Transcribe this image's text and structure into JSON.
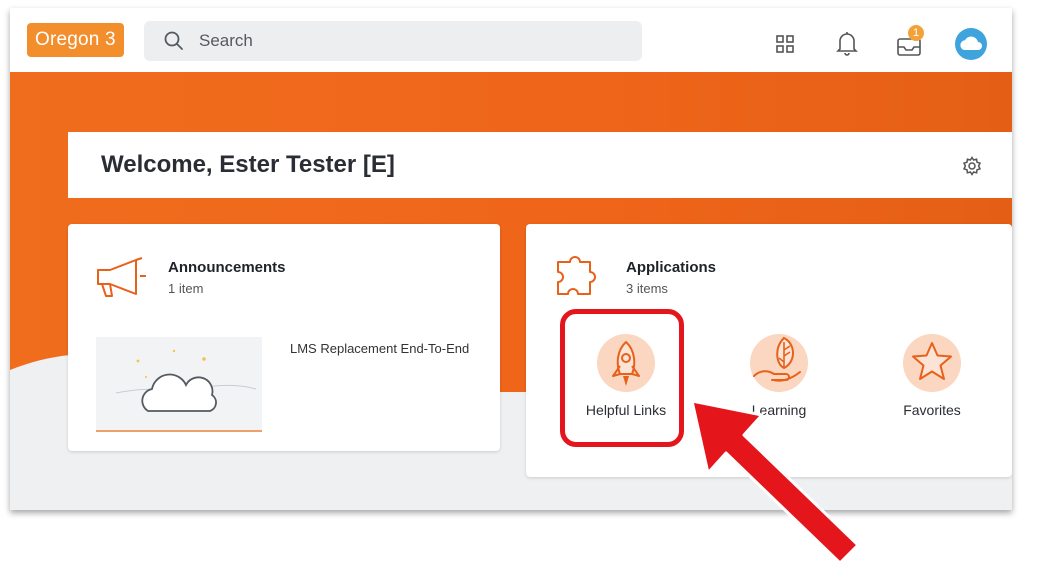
{
  "topbar": {
    "tenant_label": "Oregon 3",
    "search_label": "Search",
    "inbox_badge": "1",
    "icons": [
      "search-icon",
      "apps-grid-icon",
      "bell-icon",
      "inbox-icon",
      "cloud-avatar-icon"
    ]
  },
  "welcome": {
    "title": "Welcome, Ester Tester [E]",
    "icon": "gear-icon"
  },
  "announcements": {
    "title": "Announcements",
    "count": "1 item",
    "icon": "megaphone-icon",
    "item_title": "LMS Replacement End-To-End",
    "item_icon": "cloud-icon"
  },
  "applications": {
    "title": "Applications",
    "count": "3 items",
    "icon": "puzzle-icon",
    "apps": [
      {
        "label": "Helpful Links",
        "icon": "rocket-icon"
      },
      {
        "label": "Learning",
        "icon": "leaf-hand-icon"
      },
      {
        "label": "Favorites",
        "icon": "star-icon"
      }
    ]
  },
  "colors": {
    "brand_orange": "#f06d1d",
    "tenant_badge": "#f38e2d",
    "highlight_red": "#e4161c",
    "avatar_blue": "#3fa3dd"
  }
}
